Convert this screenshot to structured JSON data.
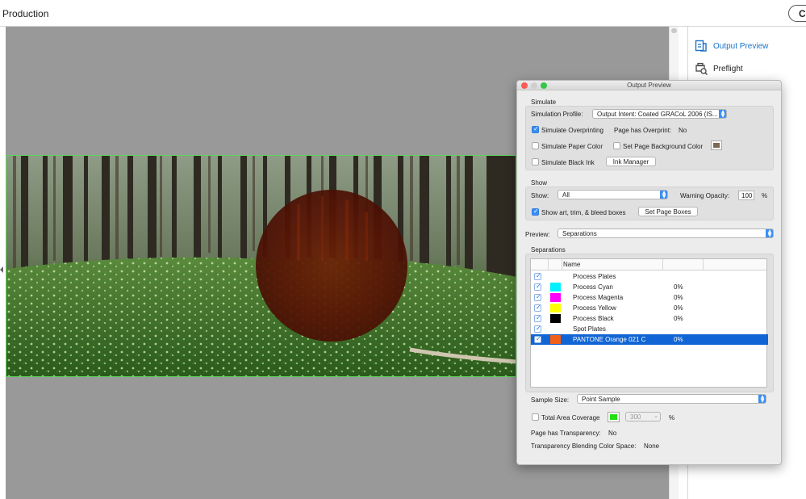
{
  "app": {
    "title": "Production",
    "close_label": "Cl"
  },
  "right_panel": {
    "tools": [
      {
        "label": "Output Preview",
        "icon": "output-preview-icon",
        "active": true
      },
      {
        "label": "Preflight",
        "icon": "preflight-icon",
        "active": false
      }
    ]
  },
  "dialog": {
    "title": "Output Preview",
    "simulate": {
      "section_label": "Simulate",
      "profile_label": "Simulation Profile:",
      "profile_value": "Output Intent: Coated GRACoL 2006 (IS...",
      "overprint_label": "Simulate Overprinting",
      "overprint_checked": true,
      "page_overprint_label": "Page has Overprint:",
      "page_overprint_value": "No",
      "paper_color_label": "Simulate Paper Color",
      "paper_color_checked": false,
      "bg_color_label": "Set Page Background Color",
      "bg_color_checked": false,
      "bg_swatch_color": "#7b6a55",
      "black_ink_label": "Simulate Black Ink",
      "black_ink_checked": false,
      "ink_manager_label": "Ink Manager"
    },
    "show": {
      "section_label": "Show",
      "show_label": "Show:",
      "show_value": "All",
      "warning_label": "Warning Opacity:",
      "warning_value": "100",
      "percent": "%",
      "boxes_label": "Show art, trim, & bleed boxes",
      "boxes_checked": true,
      "page_boxes_label": "Set Page Boxes"
    },
    "preview": {
      "label": "Preview:",
      "value": "Separations"
    },
    "separations": {
      "section_label": "Separations",
      "column_name": "Name",
      "rows": [
        {
          "name": "Process Plates",
          "color": "",
          "percent": "",
          "selected": false
        },
        {
          "name": "Process Cyan",
          "color": "#00f0ff",
          "percent": "0%",
          "selected": false
        },
        {
          "name": "Process Magenta",
          "color": "#ff00ff",
          "percent": "0%",
          "selected": false
        },
        {
          "name": "Process Yellow",
          "color": "#ffff00",
          "percent": "0%",
          "selected": false
        },
        {
          "name": "Process Black",
          "color": "#000000",
          "percent": "0%",
          "selected": false
        },
        {
          "name": "Spot Plates",
          "color": "",
          "percent": "",
          "selected": false
        },
        {
          "name": "PANTONE Orange 021 C",
          "color": "#f06018",
          "percent": "0%",
          "selected": true
        }
      ]
    },
    "sample": {
      "label": "Sample Size:",
      "value": "Point Sample"
    },
    "coverage": {
      "label": "Total Area Coverage",
      "checked": false,
      "swatch_color": "#22e014",
      "value": "300",
      "percent": "%"
    },
    "transparency": {
      "label": "Page has Transparency:",
      "value": "No",
      "blend_label": "Transparency Blending Color Space:",
      "blend_value": "None"
    }
  },
  "colors": {
    "accent": "#3b8ef5",
    "selection": "#1165d4",
    "canvas": "#999999",
    "artwork_border": "#5cd65c",
    "overlay_circle": "#5a1400"
  }
}
